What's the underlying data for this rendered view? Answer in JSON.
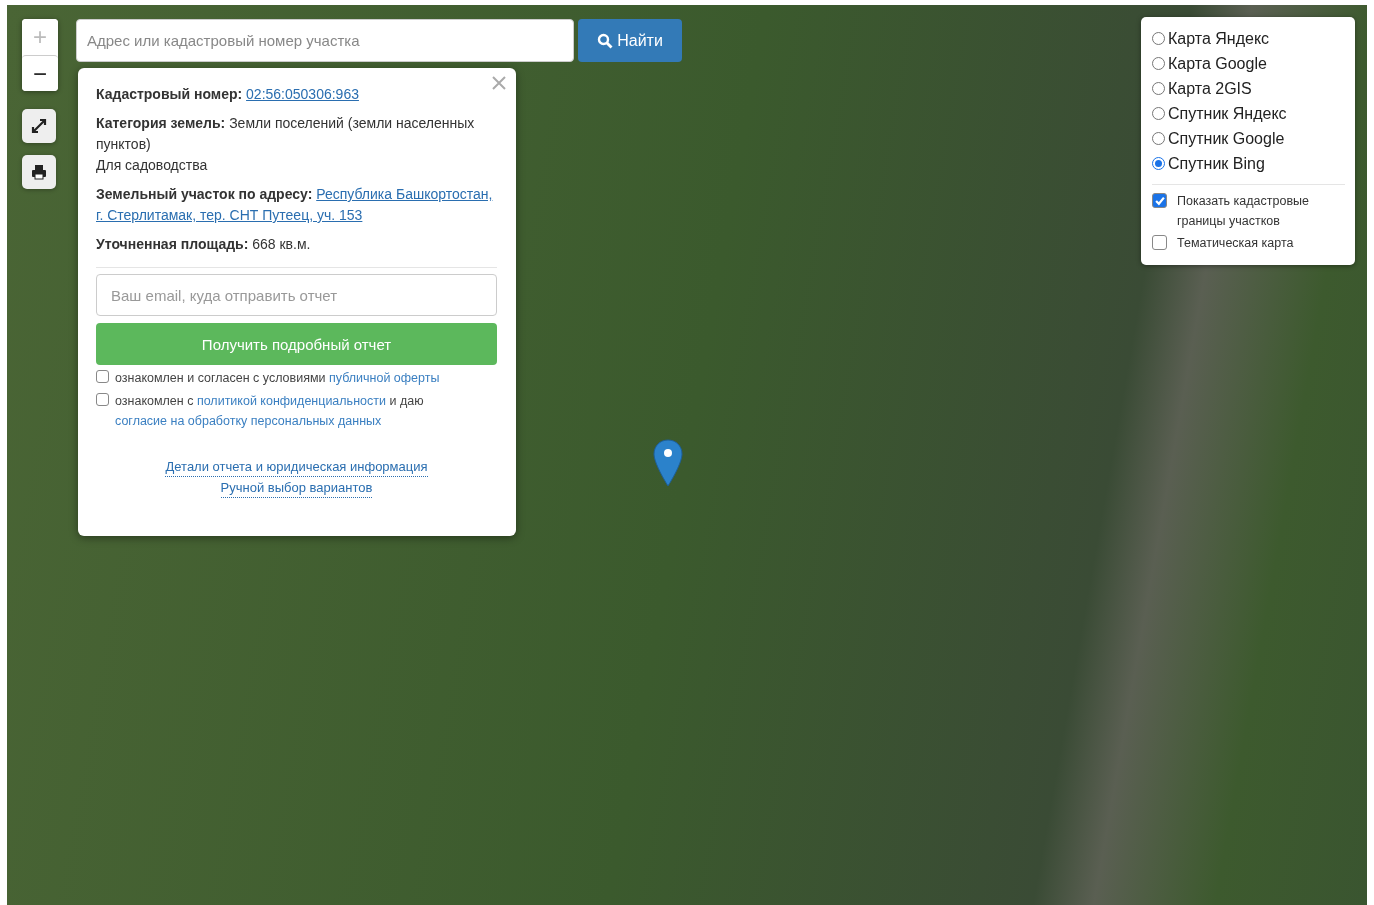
{
  "map_controls": {
    "zoom_in": "+",
    "zoom_out": "−"
  },
  "search": {
    "placeholder": "Адрес или кадастровый номер участка",
    "button": "Найти"
  },
  "popup": {
    "cadastral_label": "Кадастровый номер:",
    "cadastral_number": "02:56:050306:963",
    "category": "**Категория земель:** Земли поселений (земли населенных пунктов)",
    "usage": "Для садоводства",
    "address_label": "Земельный участок по адресу:",
    "address": "Республика Башкортостан, г. Стерлитамак, тер. СНТ Путеец, уч. 153",
    "area": "**Уточненная площадь:** 668 кв.м.",
    "email_placeholder": "Ваш email, куда отправить отчет",
    "submit": "Получить подробный отчет",
    "agreements": [
      {
        "checked": false,
        "parts": [
          {
            "text": "ознакомлен и согласен с условиями ",
            "link": false
          },
          {
            "text": "публичной оферты",
            "link": true
          }
        ]
      },
      {
        "checked": false,
        "parts": [
          {
            "text": "ознакомлен с ",
            "link": false
          },
          {
            "text": "политикой конфиденциальности",
            "link": true
          },
          {
            "text": " и даю ",
            "link": false
          },
          {
            "text": "согласие на обработку персональных данных",
            "link": true
          }
        ]
      }
    ],
    "footer_links": [
      "Детали отчета и юридическая информация",
      "Ручной выбор вариантов"
    ]
  },
  "layers": {
    "base_maps": [
      {
        "label": "Карта Яндекс",
        "selected": false
      },
      {
        "label": "Карта Google",
        "selected": false
      },
      {
        "label": "Карта 2GIS",
        "selected": false
      },
      {
        "label": "Спутник Яндекс",
        "selected": false
      },
      {
        "label": "Спутник Google",
        "selected": false
      },
      {
        "label": "Спутник Bing",
        "selected": true
      }
    ],
    "overlays": [
      {
        "label": "Показать кадастровые границы участков",
        "checked": true
      },
      {
        "label": "Тематическая карта",
        "checked": false
      }
    ]
  }
}
